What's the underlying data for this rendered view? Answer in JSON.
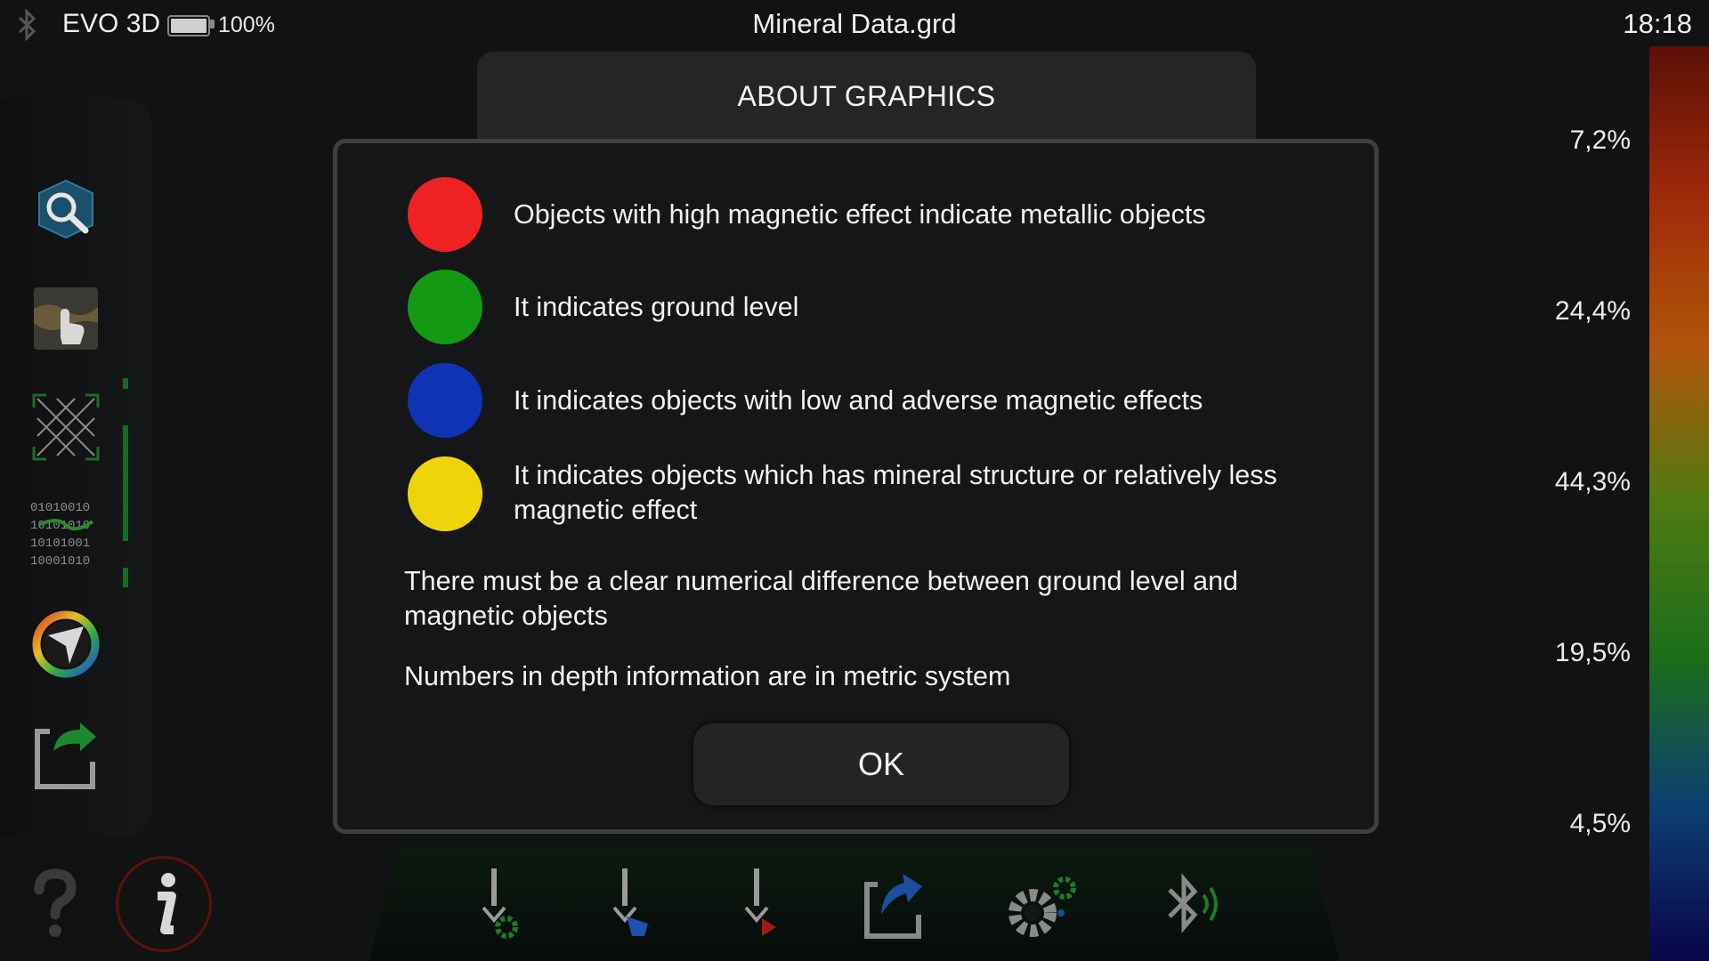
{
  "status_bar": {
    "device_name": "EVO 3D",
    "battery_percent": "100%",
    "battery_level": 1.0,
    "file_name": "Mineral Data.grd",
    "time": "18:18"
  },
  "color_scale": {
    "labels": [
      "7,2%",
      "24,4%",
      "44,3%",
      "19,5%",
      "4,5%"
    ],
    "gradient_colors": [
      "#5c0f07",
      "#a02a0a",
      "#b0560a",
      "#4f7a12",
      "#1c6e1a",
      "#0c3e72",
      "#09044a"
    ]
  },
  "dialog": {
    "title": "ABOUT GRAPHICS",
    "legend": [
      {
        "color": "#ee2222",
        "text": "Objects with high magnetic effect indicate metallic objects"
      },
      {
        "color": "#149914",
        "text": "It indicates ground level"
      },
      {
        "color": "#0f33b4",
        "text": "It indicates objects with low and adverse magnetic effects"
      },
      {
        "color": "#f0d40a",
        "text": "It indicates objects which has mineral structure or relatively less magnetic effect"
      }
    ],
    "note_1": "There must be a clear numerical difference between ground level and magnetic objects",
    "note_2": "Numbers in depth information are in metric system",
    "ok_label": "OK"
  },
  "left_toolbar": {
    "items": [
      "3d-view-icon",
      "hand-scan-icon",
      "grid-filter-icon",
      "binary-data-icon",
      "color-wheel-icon",
      "export-file-icon"
    ],
    "bottom": [
      "help-icon",
      "info-icon"
    ]
  },
  "bottom_toolbar": {
    "items": [
      "probe-settings-icon",
      "probe-hand-icon",
      "probe-play-icon",
      "share-icon",
      "settings-icon",
      "bluetooth-icon"
    ]
  }
}
